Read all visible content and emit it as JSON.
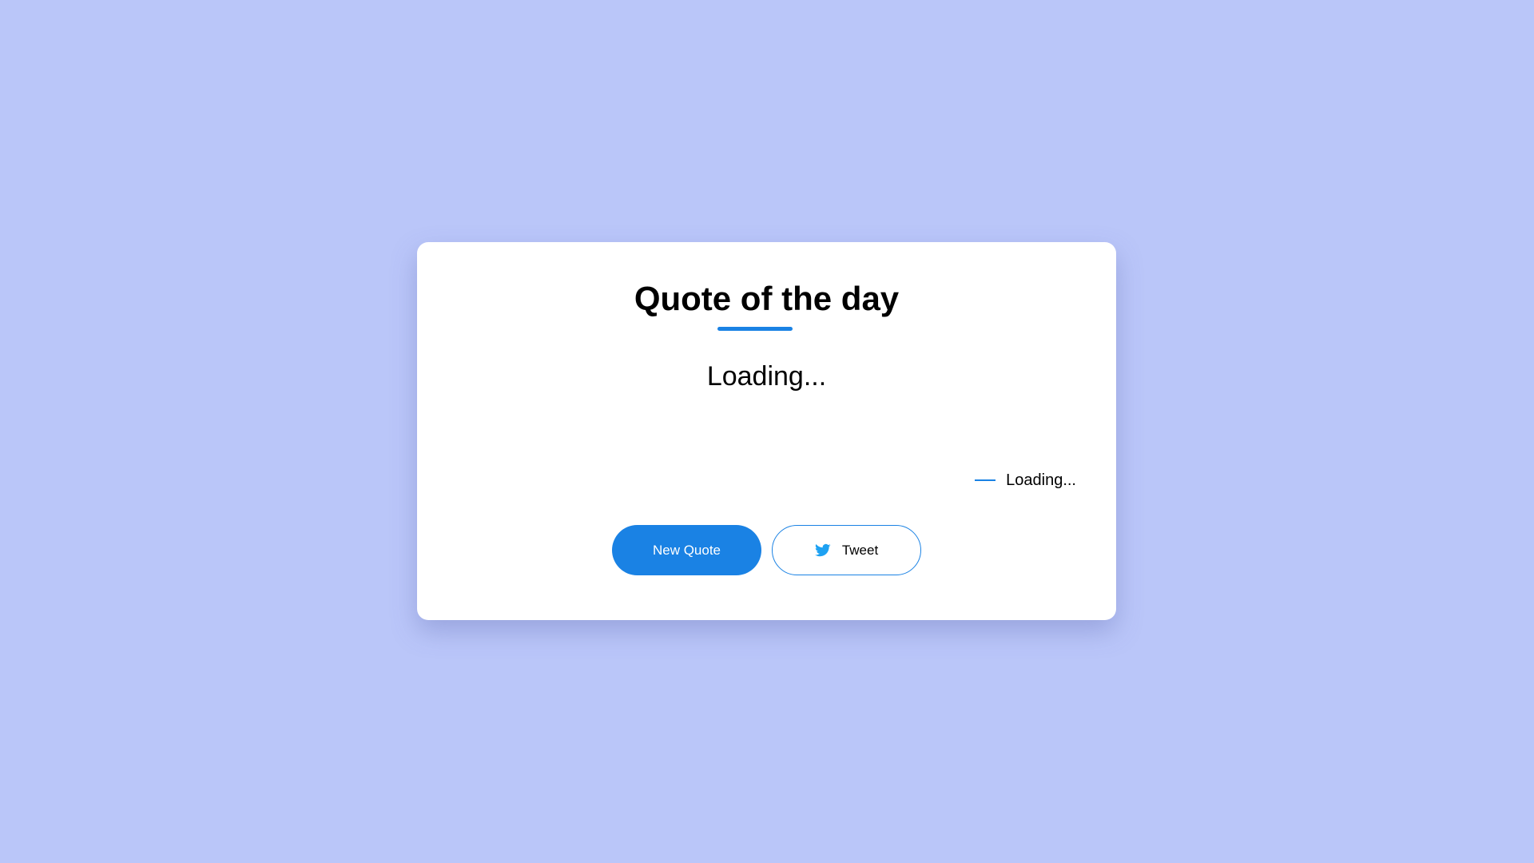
{
  "colors": {
    "page_background": "#bac6f9",
    "accent": "#1a82e4",
    "twitter_blue": "#1da1f2",
    "card_background": "#ffffff"
  },
  "card": {
    "title": "Quote of the day",
    "quote_text": "Loading...",
    "author_text": "Loading..."
  },
  "buttons": {
    "new_quote_label": "New Quote",
    "tweet_label": "Tweet",
    "tweet_icon": "twitter-bird-icon"
  }
}
